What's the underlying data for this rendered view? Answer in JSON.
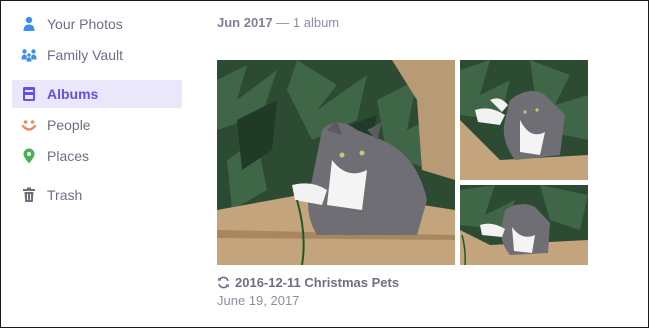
{
  "sidebar": {
    "items": [
      {
        "label": "Your Photos",
        "icon": "person-icon",
        "active": false
      },
      {
        "label": "Family Vault",
        "icon": "family-icon",
        "active": false
      },
      {
        "label": "Albums",
        "icon": "album-icon",
        "active": true
      },
      {
        "label": "People",
        "icon": "smile-icon",
        "active": false
      },
      {
        "label": "Places",
        "icon": "pin-icon",
        "active": false
      },
      {
        "label": "Trash",
        "icon": "trash-icon",
        "active": false
      }
    ]
  },
  "main": {
    "month": "Jun 2017",
    "separator": " — ",
    "count": "1 album",
    "album": {
      "title": "2016-12-11 Christmas Pets",
      "date": "June 19, 2017"
    }
  },
  "colors": {
    "accent": "#6a4de3",
    "active_bg": "#ebe7fb",
    "icon_blue": "#3f8fe6",
    "icon_orange": "#f08a5d",
    "icon_green": "#4caf50",
    "icon_gray": "#6d6f7a"
  }
}
